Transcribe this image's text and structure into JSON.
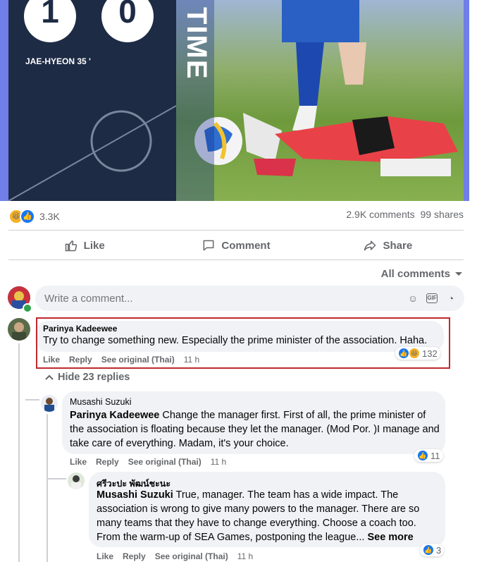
{
  "post_image": {
    "home_score": "1",
    "away_score": "0",
    "scorer": "JAE-HYEON 35 '",
    "overlay_text": "TIME"
  },
  "stats": {
    "reaction_count": "3.3K",
    "comments": "2.9K comments",
    "shares": "99 shares"
  },
  "actions": {
    "like": "Like",
    "comment": "Comment",
    "share": "Share"
  },
  "filter": {
    "label": "All comments"
  },
  "composer": {
    "placeholder": "Write a comment..."
  },
  "comments": [
    {
      "author": "Parinya Kadeewee",
      "text": "Try to change something new. Especially the prime minister of the association. Haha.",
      "like": "Like",
      "reply": "Reply",
      "see_original": "See original (Thai)",
      "time": "11 h",
      "reactions": "132"
    }
  ],
  "hide_replies": "Hide 23 replies",
  "replies": [
    {
      "author": "Musashi Suzuki",
      "mention": "Parinya Kadeewee",
      "text": " Change the manager first. First of all, the prime minister of the association is floating because they let the manager. (Mod Por. )I manage and take care of everything. Madam, it's your choice.",
      "like": "Like",
      "reply": "Reply",
      "see_original": "See original (Thai)",
      "time": "11 h",
      "reactions": "11"
    },
    {
      "author": "ศรีวะปะ พัฒน์ชะนะ",
      "mention": "Musashi Suzuki",
      "text": " True, manager. The team has a wide impact. The association is wrong to give many powers to the manager. There are so many teams that they have to change everything. Choose a coach too. From the warm-up of SEA Games, postponing the league...",
      "see_more": "See more",
      "like": "Like",
      "reply": "Reply",
      "see_original": "See original (Thai)",
      "time": "11 h",
      "reactions": "3"
    }
  ],
  "colors": {
    "like_blue": "#1877f2",
    "highlight_red": "#c0282d",
    "bubble_gray": "#f0f2f5"
  }
}
